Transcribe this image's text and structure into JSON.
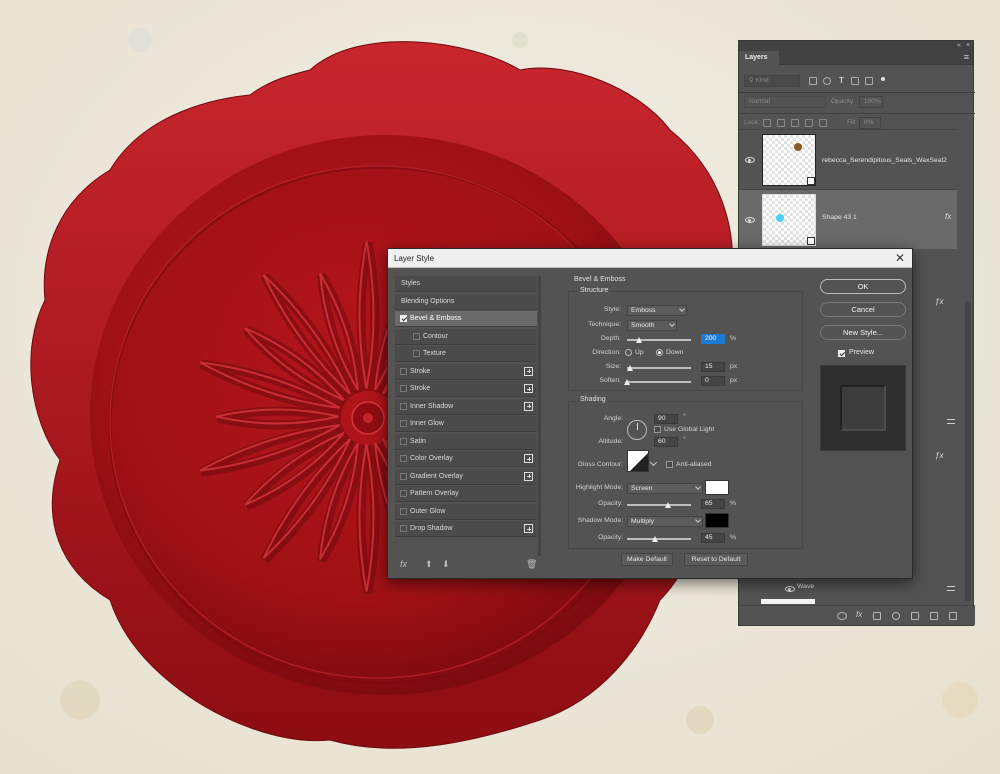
{
  "colors": {
    "panel_bg": "#535353",
    "wax_red": "#a31116",
    "highlight_color": "#ffffff",
    "shadow_color": "#000000",
    "focus_blue": "#1e79d4"
  },
  "layers_panel": {
    "tab": "Layers",
    "menu_icon": "panel-menu-icon",
    "filter_placeholder": "Kind",
    "blend_mode": "Normal",
    "opacity_label": "Opacity:",
    "opacity_value": "100%",
    "lock_label": "Lock:",
    "fill_label": "Fill:",
    "fill_value": "0%",
    "layers": [
      {
        "name": "rebecca_Serendipitous_Seals_WaxSeal2"
      },
      {
        "name": "Shape 43 1",
        "fx": "fx"
      }
    ],
    "wave_label": "Wave"
  },
  "dialog": {
    "title": "Layer Style",
    "close": "✕",
    "styles_list": [
      {
        "label": "Styles",
        "kind": "plain"
      },
      {
        "label": "Blending Options",
        "kind": "plain"
      },
      {
        "label": "Bevel & Emboss",
        "kind": "check",
        "checked": true,
        "active": true
      },
      {
        "label": "Contour",
        "kind": "sub",
        "checked": false
      },
      {
        "label": "Texture",
        "kind": "sub",
        "checked": false
      },
      {
        "label": "Stroke",
        "kind": "check",
        "plus": true
      },
      {
        "label": "Stroke",
        "kind": "check",
        "plus": true
      },
      {
        "label": "Inner Shadow",
        "kind": "check",
        "plus": true
      },
      {
        "label": "Inner Glow",
        "kind": "check"
      },
      {
        "label": "Satin",
        "kind": "check"
      },
      {
        "label": "Color Overlay",
        "kind": "check",
        "plus": true
      },
      {
        "label": "Gradient Overlay",
        "kind": "check",
        "plus": true
      },
      {
        "label": "Pattern Overlay",
        "kind": "check"
      },
      {
        "label": "Outer Glow",
        "kind": "check"
      },
      {
        "label": "Drop Shadow",
        "kind": "check",
        "plus": true
      }
    ],
    "bottom_icons": [
      "fx-icon",
      "arrow-up-icon",
      "arrow-down-icon",
      "trash-icon"
    ],
    "bevel": {
      "heading": "Bevel & Emboss",
      "structure_heading": "Structure",
      "style_label": "Style:",
      "style_value": "Emboss",
      "technique_label": "Technique:",
      "technique_value": "Smooth",
      "depth_label": "Depth:",
      "depth_value": "200",
      "depth_unit": "%",
      "depth_level": 0.2,
      "direction_label": "Direction:",
      "dir_up": "Up",
      "dir_down": "Down",
      "direction_selected": "Down",
      "size_label": "Size:",
      "size_value": "15",
      "size_unit": "px",
      "size_level": 0.06,
      "soften_label": "Soften:",
      "soften_value": "0",
      "soften_unit": "px",
      "soften_level": 0.0,
      "shading_heading": "Shading",
      "angle_label": "Angle:",
      "angle_value": "90",
      "angle_unit": "°",
      "use_global_light": "Use Global Light",
      "altitude_label": "Altitude:",
      "altitude_value": "60",
      "altitude_unit": "°",
      "gloss_contour_label": "Gloss Contour:",
      "anti_aliased": "Anti-aliased",
      "highlight_mode_label": "Highlight Mode:",
      "highlight_mode_value": "Screen",
      "highlight_opacity_label": "Opacity:",
      "highlight_opacity_value": "65",
      "highlight_opacity_level": 0.65,
      "shadow_mode_label": "Shadow Mode:",
      "shadow_mode_value": "Multiply",
      "shadow_opacity_label": "Opacity:",
      "shadow_opacity_value": "45",
      "shadow_opacity_level": 0.45,
      "percent": "%",
      "make_default": "Make Default",
      "reset_default": "Reset to Default"
    },
    "buttons": {
      "ok": "OK",
      "cancel": "Cancel",
      "new_style": "New Style...",
      "preview": "Preview"
    }
  }
}
